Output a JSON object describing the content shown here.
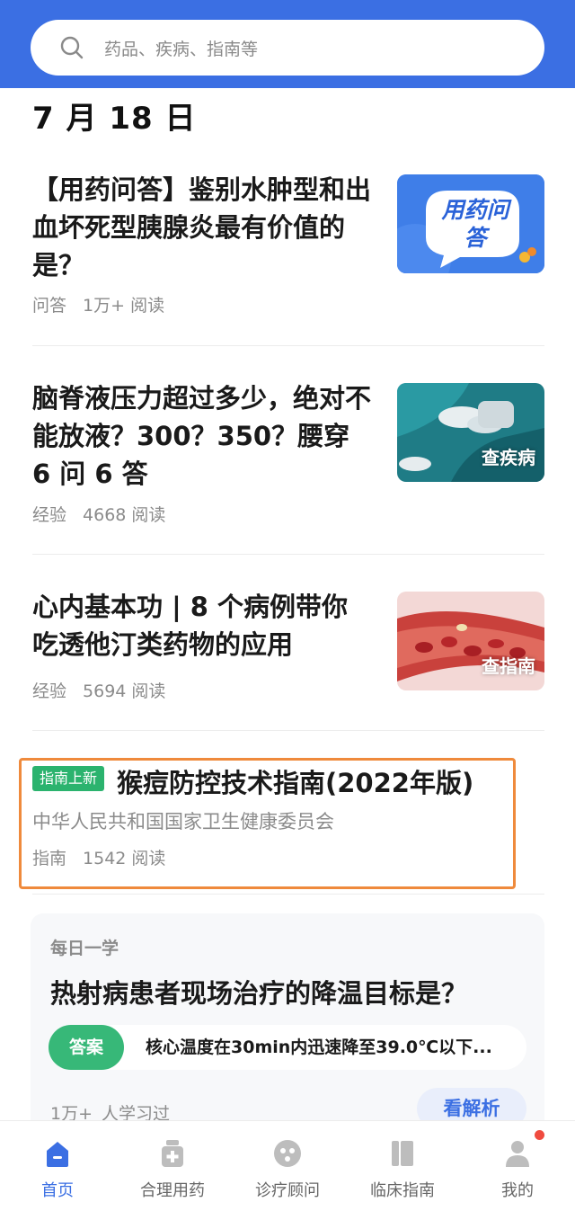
{
  "search": {
    "placeholder": "药品、疾病、指南等"
  },
  "date": "7 月 18 日",
  "articles": [
    {
      "title": "【用药问答】鉴别水肿型和出血坏死型胰腺炎最有价值的是？",
      "category": "问答",
      "reads": "1万+ 阅读",
      "thumb_text": "用药问答"
    },
    {
      "title": "脑脊液压力超过多少，绝对不能放液？300？350？腰穿 6 问 6 答",
      "category": "经验",
      "reads": "4668 阅读",
      "thumb_badge": "查疾病"
    },
    {
      "title": "心内基本功 | 8 个病例带你吃透他汀类药物的应用",
      "category": "经验",
      "reads": "5694 阅读",
      "thumb_badge": "查指南"
    }
  ],
  "guide": {
    "tag": "指南上新",
    "title": "猴痘防控技术指南(2022年版)",
    "org": "中华人民共和国国家卫生健康委员会",
    "category": "指南",
    "reads": "1542 阅读"
  },
  "daily": {
    "label": "每日一学",
    "question": "热射病患者现场治疗的降温目标是？",
    "answer_label": "答案",
    "answer_text": "核心温度在30min内迅速降至39.0℃以下...",
    "learners_count": "1万+",
    "learners_text": "人学习过",
    "analysis_button": "看解析"
  },
  "nav": {
    "items": [
      {
        "label": "首页",
        "icon": "home-icon",
        "active": true
      },
      {
        "label": "合理用药",
        "icon": "medicine-box-icon",
        "active": false
      },
      {
        "label": "诊疗顾问",
        "icon": "consult-icon",
        "active": false
      },
      {
        "label": "临床指南",
        "icon": "book-icon",
        "active": false
      },
      {
        "label": "我的",
        "icon": "user-icon",
        "active": false
      }
    ]
  },
  "colors": {
    "brand_blue": "#3b6fe3",
    "green": "#2bb36e",
    "highlight_orange": "#ef8a3c",
    "notification_red": "#f04b3f"
  }
}
